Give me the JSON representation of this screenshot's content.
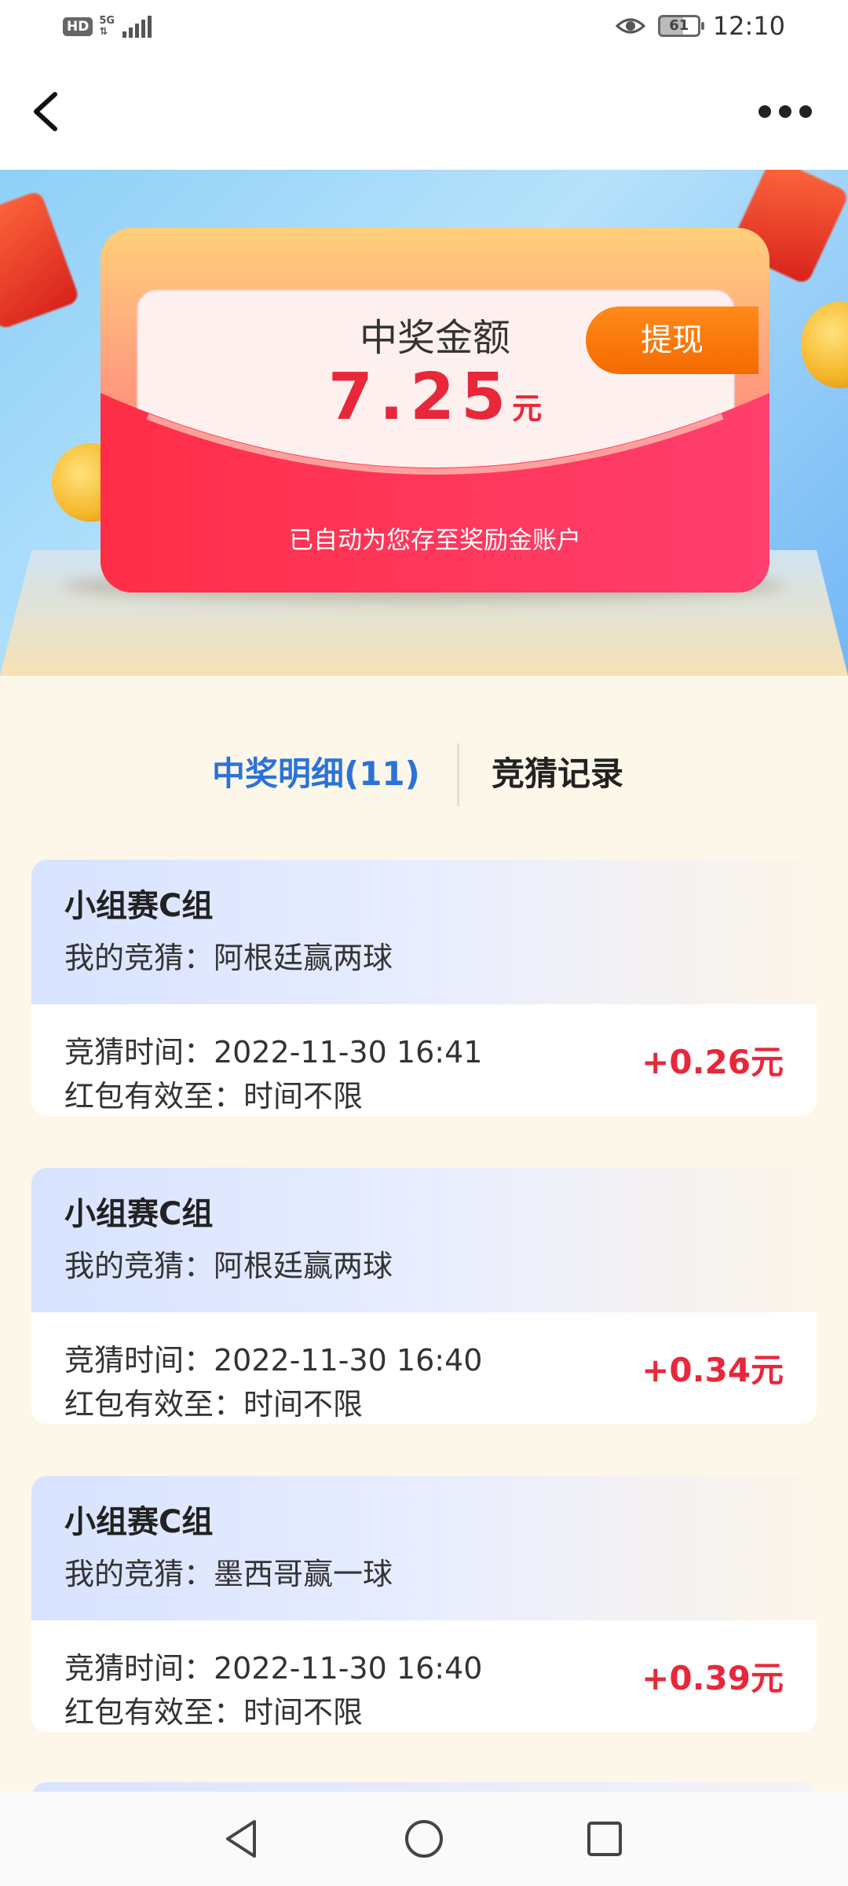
{
  "status_bar": {
    "hd_label": "HD",
    "network": "5G",
    "battery": "61",
    "time": "12:10"
  },
  "header": {
    "back_icon": "chevron-left-icon",
    "more_icon": "more-dots-icon"
  },
  "prize": {
    "title": "中奖金额",
    "amount": "7.25",
    "unit": "元",
    "withdraw_label": "提现",
    "note": "已自动为您存至奖励金账户"
  },
  "tabs": {
    "win_details": "中奖明细(11)",
    "guess_records": "竞猜记录",
    "active_color": "#2b73d8"
  },
  "records": [
    {
      "group": "小组赛C组",
      "guess": "我的竞猜：阿根廷赢两球",
      "time": "竞猜时间：2022-11-30 16:41",
      "valid": "红包有效至：时间不限",
      "reward": "+0.26元"
    },
    {
      "group": "小组赛C组",
      "guess": "我的竞猜：阿根廷赢两球",
      "time": "竞猜时间：2022-11-30 16:40",
      "valid": "红包有效至：时间不限",
      "reward": "+0.34元"
    },
    {
      "group": "小组赛C组",
      "guess": "我的竞猜：墨西哥赢一球",
      "time": "竞猜时间：2022-11-30 16:40",
      "valid": "红包有效至：时间不限",
      "reward": "+0.39元"
    }
  ],
  "nav": {
    "back": "triangle-back-icon",
    "home": "circle-home-icon",
    "recents": "square-recents-icon"
  },
  "colors": {
    "accent_red": "#e8283a",
    "withdraw_orange": "#f56a00"
  }
}
